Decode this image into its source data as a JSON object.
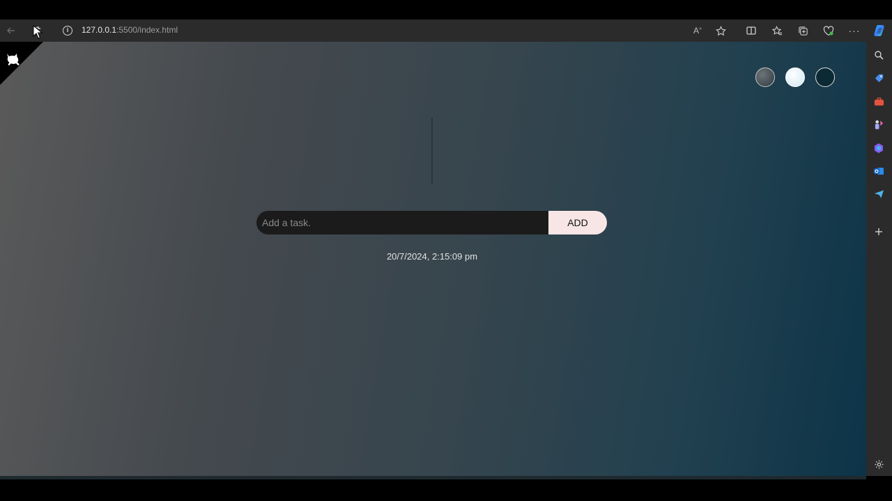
{
  "browser": {
    "url_host": "127.0.0.1",
    "url_path": ":5500/index.html",
    "toolbar_icons": [
      "back-arrow-icon",
      "refresh-icon",
      "site-info-icon",
      "read-aloud-icon",
      "favorite-star-icon",
      "split-screen-icon",
      "favorites-icon",
      "collections-icon",
      "browser-essentials-icon",
      "more-options-icon",
      "copilot-icon"
    ],
    "sidebar_icons": [
      "search-icon",
      "shopping-tag-icon",
      "tools-icon",
      "games-icon",
      "microsoft-365-icon",
      "outlook-icon",
      "send-icon",
      "add-icon",
      "settings-icon"
    ]
  },
  "app": {
    "theme_dots": [
      "dark-gray",
      "light-blue",
      "dark-teal"
    ],
    "task_input": {
      "placeholder": "Add a task."
    },
    "add_button_label": "ADD",
    "datetime": "20/7/2024, 2:15:09 pm"
  },
  "colors": {
    "accent_button": "#f8e6e6",
    "input_bg": "#1b1b1b",
    "gradient_start": "#5a5a5a",
    "gradient_end": "#0c3448"
  }
}
